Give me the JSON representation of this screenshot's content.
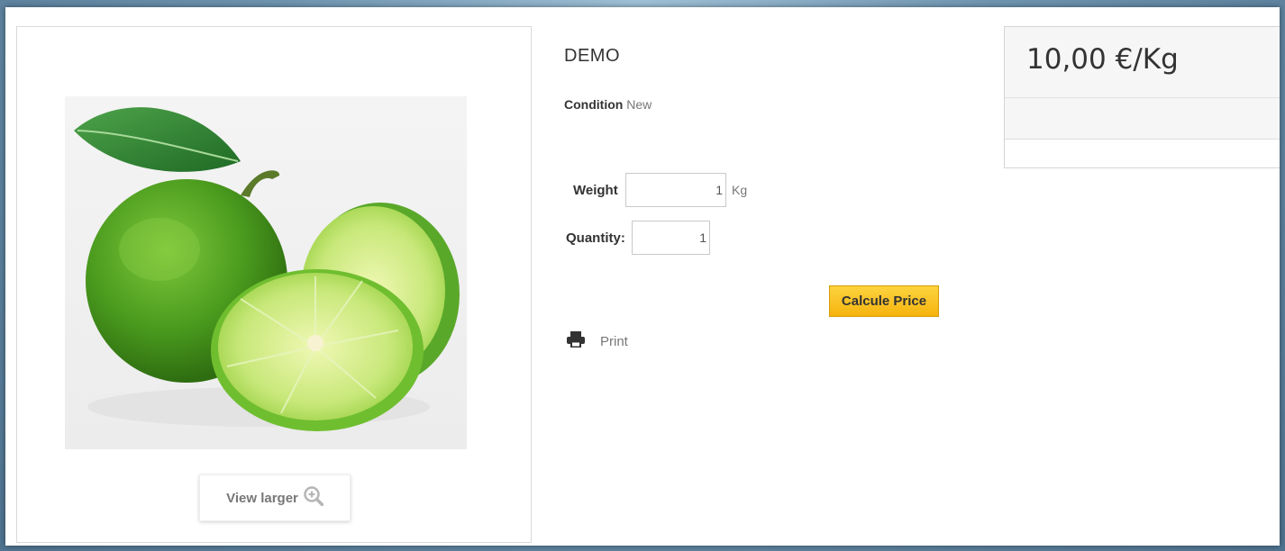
{
  "product": {
    "name": "DEMO",
    "condition_label": "Condition",
    "condition_value": "New",
    "price": "10,00 €/Kg"
  },
  "form": {
    "weight_label": "Weight",
    "weight_value": "1",
    "weight_unit": "Kg",
    "quantity_label": "Quantity:",
    "quantity_value": "1",
    "calculate_label": "Calcule Price"
  },
  "actions": {
    "view_larger_label": "View larger",
    "print_label": "Print"
  },
  "icons": {
    "zoom": "zoom-in-icon",
    "print": "printer-icon"
  },
  "colors": {
    "calculate_button": "#f8c21b",
    "zoom_icon": "#b5b5b5"
  }
}
